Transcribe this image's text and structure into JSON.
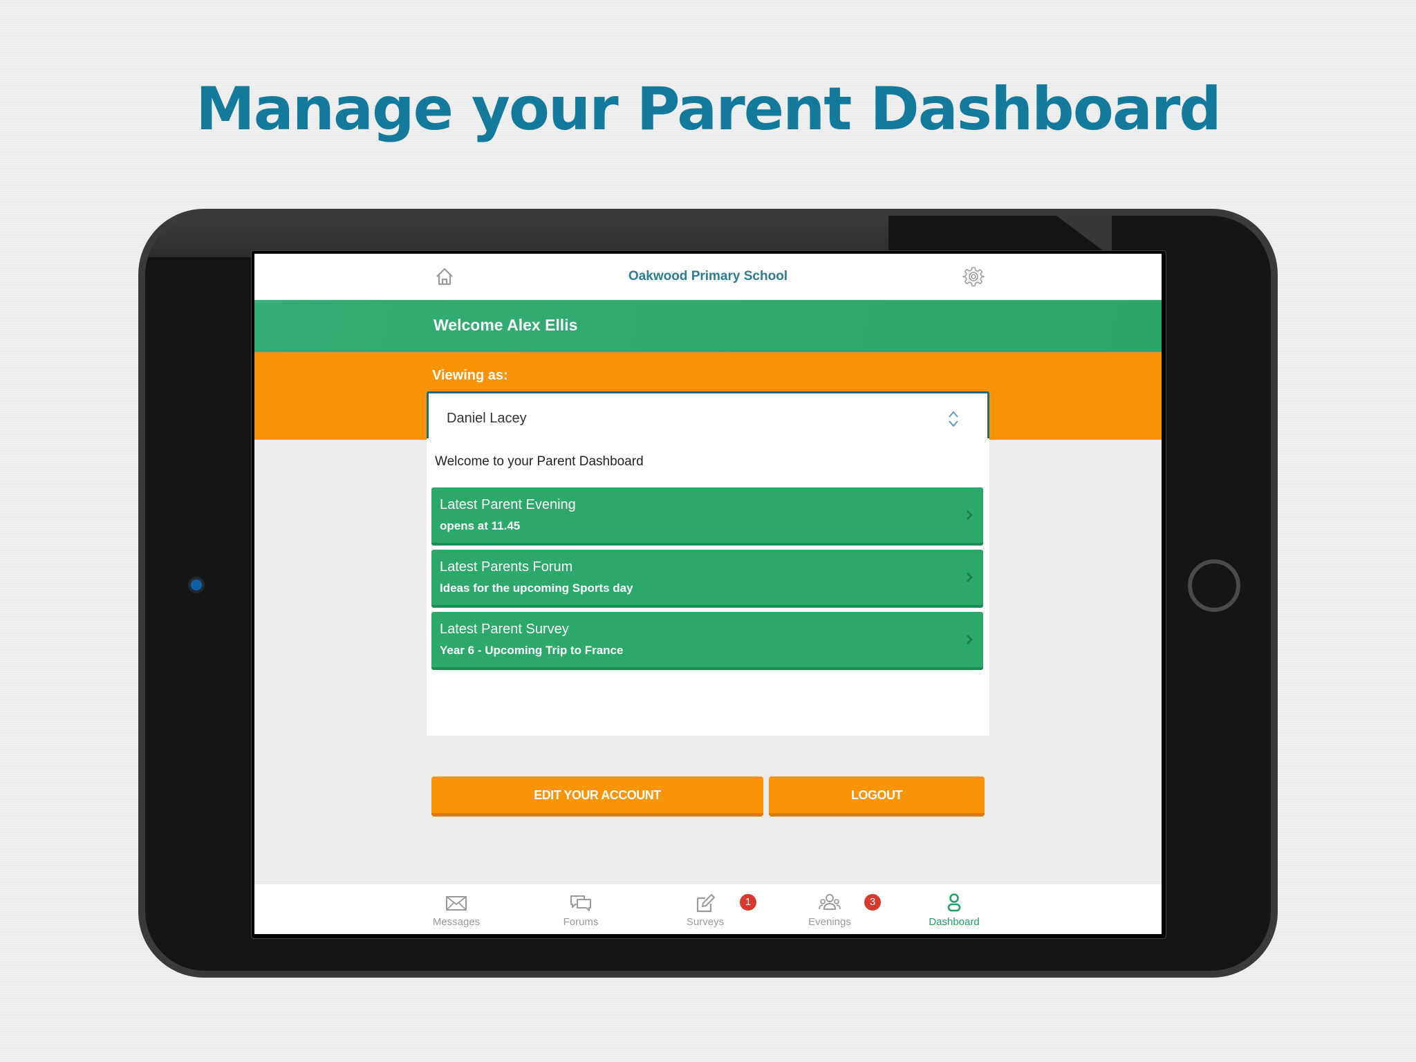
{
  "headline": "Manage your Parent Dashboard",
  "app": {
    "school_name": "Oakwood Primary School",
    "welcome": "Welcome Alex Ellis",
    "viewing_as_label": "Viewing as:",
    "viewing_as_value": "Daniel Lacey",
    "intro": "Welcome to your Parent Dashboard",
    "cards": [
      {
        "title": "Latest Parent Evening",
        "subtitle": "opens at 11.45"
      },
      {
        "title": "Latest Parents Forum",
        "subtitle": "Ideas for the upcoming Sports day"
      },
      {
        "title": "Latest Parent Survey",
        "subtitle": "Year 6 - Upcoming Trip to France"
      }
    ],
    "buttons": {
      "edit_account": "EDIT YOUR ACCOUNT",
      "logout": "LOGOUT"
    },
    "tabs": [
      {
        "label": "Messages",
        "icon": "envelope-icon",
        "badge": null,
        "active": false
      },
      {
        "label": "Forums",
        "icon": "chat-bubbles-icon",
        "badge": null,
        "active": false
      },
      {
        "label": "Surveys",
        "icon": "edit-pencil-icon",
        "badge": "1",
        "active": false
      },
      {
        "label": "Evenings",
        "icon": "group-icon",
        "badge": "3",
        "active": false
      },
      {
        "label": "Dashboard",
        "icon": "person-icon",
        "badge": null,
        "active": true
      }
    ]
  },
  "colors": {
    "headline": "#147a9b",
    "green": "#2ca86a",
    "orange": "#f89406",
    "select_border": "#1b6c86",
    "badge": "#d63a2c"
  }
}
